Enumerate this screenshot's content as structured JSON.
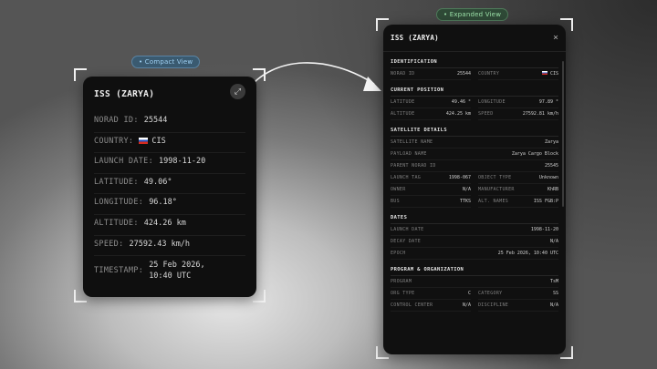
{
  "labels": {
    "compact": "• Compact View",
    "expanded": "• Expanded View"
  },
  "compact": {
    "title": "ISS (ZARYA)",
    "rows": [
      {
        "label": "NORAD ID:",
        "value": "25544"
      },
      {
        "label": "COUNTRY:",
        "value": "CIS",
        "flag": true
      },
      {
        "label": "LAUNCH DATE:",
        "value": "1998-11-20"
      },
      {
        "label": "LATITUDE:",
        "value": "49.06°"
      },
      {
        "label": "LONGITUDE:",
        "value": "96.18°"
      },
      {
        "label": "ALTITUDE:",
        "value": "424.26 km"
      },
      {
        "label": "SPEED:",
        "value": "27592.43 km/h"
      }
    ],
    "timestamp": {
      "label": "TIMESTAMP:",
      "line1": "25 Feb 2026,",
      "line2": "10:40 UTC"
    }
  },
  "expanded": {
    "title": "ISS (ZARYA)",
    "close": "×",
    "identification": {
      "heading": "IDENTIFICATION",
      "norad_label": "NORAD ID",
      "norad_value": "25544",
      "country_label": "COUNTRY",
      "country_value": "CIS"
    },
    "position": {
      "heading": "CURRENT POSITION",
      "lat_label": "LATITUDE",
      "lat_value": "49.46 °",
      "lon_label": "LONGITUDE",
      "lon_value": "97.89 °",
      "alt_label": "ALTITUDE",
      "alt_value": "424.25 km",
      "speed_label": "SPEED",
      "speed_value": "27592.81 km/h"
    },
    "details": {
      "heading": "SATELLITE DETAILS",
      "sat_name_label": "SATELLITE NAME",
      "sat_name_value": "Zarya",
      "payload_label": "PAYLOAD NAME",
      "payload_value": "Zarya Cargo Block",
      "parent_label": "PARENT NORAD ID",
      "parent_value": "25545",
      "launch_tag_label": "LAUNCH TAG",
      "launch_tag_value": "1998-067",
      "object_type_label": "OBJECT TYPE",
      "object_type_value": "Unknown",
      "owner_label": "OWNER",
      "owner_value": "N/A",
      "manufacturer_label": "MANUFACTURER",
      "manufacturer_value": "KhRB",
      "bus_label": "BUS",
      "bus_value": "TTKS",
      "alt_names_label": "ALT. NAMES",
      "alt_names_value": "ISS FGB:P"
    },
    "dates": {
      "heading": "DATES",
      "launch_label": "LAUNCH DATE",
      "launch_value": "1998-11-20",
      "decay_label": "DECAY DATE",
      "decay_value": "N/A",
      "epoch_label": "EPOCH",
      "epoch_value": "25 Feb 2026, 10:40 UTC"
    },
    "program": {
      "heading": "PROGRAM & ORGANIZATION",
      "program_label": "PROGRAM",
      "program_value": "TsM",
      "org_type_label": "ORG TYPE",
      "org_type_value": "C",
      "category_label": "CATEGORY",
      "category_value": "SS",
      "control_label": "CONTROL CENTER",
      "control_value": "N/A",
      "discipline_label": "DISCIPLINE",
      "discipline_value": "N/A"
    }
  }
}
